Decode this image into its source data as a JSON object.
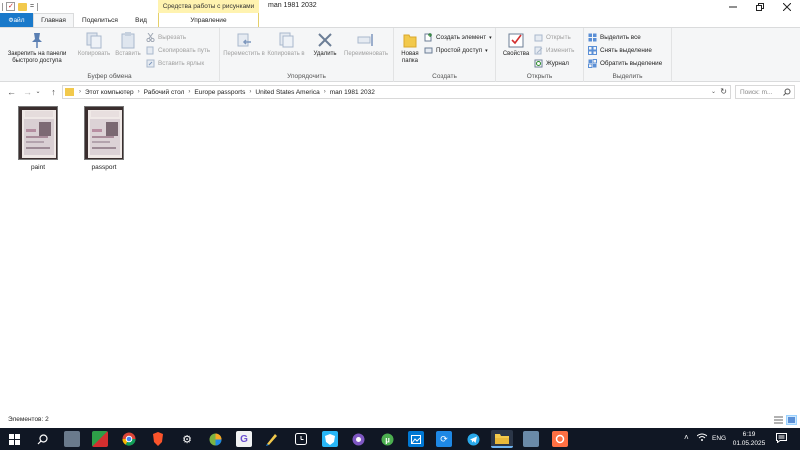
{
  "window": {
    "title": "man 1981 2032",
    "context_tab_group": "Средства работы с рисунками",
    "qat_separator": "="
  },
  "tabs": {
    "file": "Файл",
    "home": "Главная",
    "share": "Поделиться",
    "view": "Вид",
    "manage": "Управление"
  },
  "ribbon": {
    "clipboard": {
      "label": "Буфер обмена",
      "pin": "Закрепить на панели быстрого доступа",
      "copy": "Копировать",
      "paste": "Вставить",
      "cut": "Вырезать",
      "copy_path": "Скопировать путь",
      "paste_shortcut": "Вставить ярлык"
    },
    "organize": {
      "label": "Упорядочить",
      "move_to": "Переместить в",
      "copy_to": "Копировать в",
      "delete": "Удалить",
      "rename": "Переименовать"
    },
    "create": {
      "label": "Создать",
      "new_folder": "Новая папка",
      "new_item": "Создать элемент",
      "easy_access": "Простой доступ"
    },
    "open": {
      "label": "Открыть",
      "properties": "Свойства",
      "open": "Открыть",
      "edit": "Изменить",
      "history": "Журнал"
    },
    "select": {
      "label": "Выделить",
      "select_all": "Выделить все",
      "select_none": "Снять выделение",
      "invert": "Обратить выделение"
    }
  },
  "address": {
    "crumbs": [
      "Этот компьютер",
      "Рабочий стол",
      "Europe passports",
      "United States America",
      "man 1981 2032"
    ],
    "search_placeholder": "Поиск: m..."
  },
  "files": [
    {
      "name": "paint"
    },
    {
      "name": "passport"
    }
  ],
  "status": {
    "items_count": "Элементов: 2"
  },
  "taskbar": {
    "language": "ENG",
    "time": "6:19",
    "date": "01.05.2025"
  },
  "colors": {
    "file_tab": "#1979ca",
    "context_tab": "#fff3b0",
    "taskbar": "#101724",
    "ribbon_bg": "#f5f6f7"
  }
}
